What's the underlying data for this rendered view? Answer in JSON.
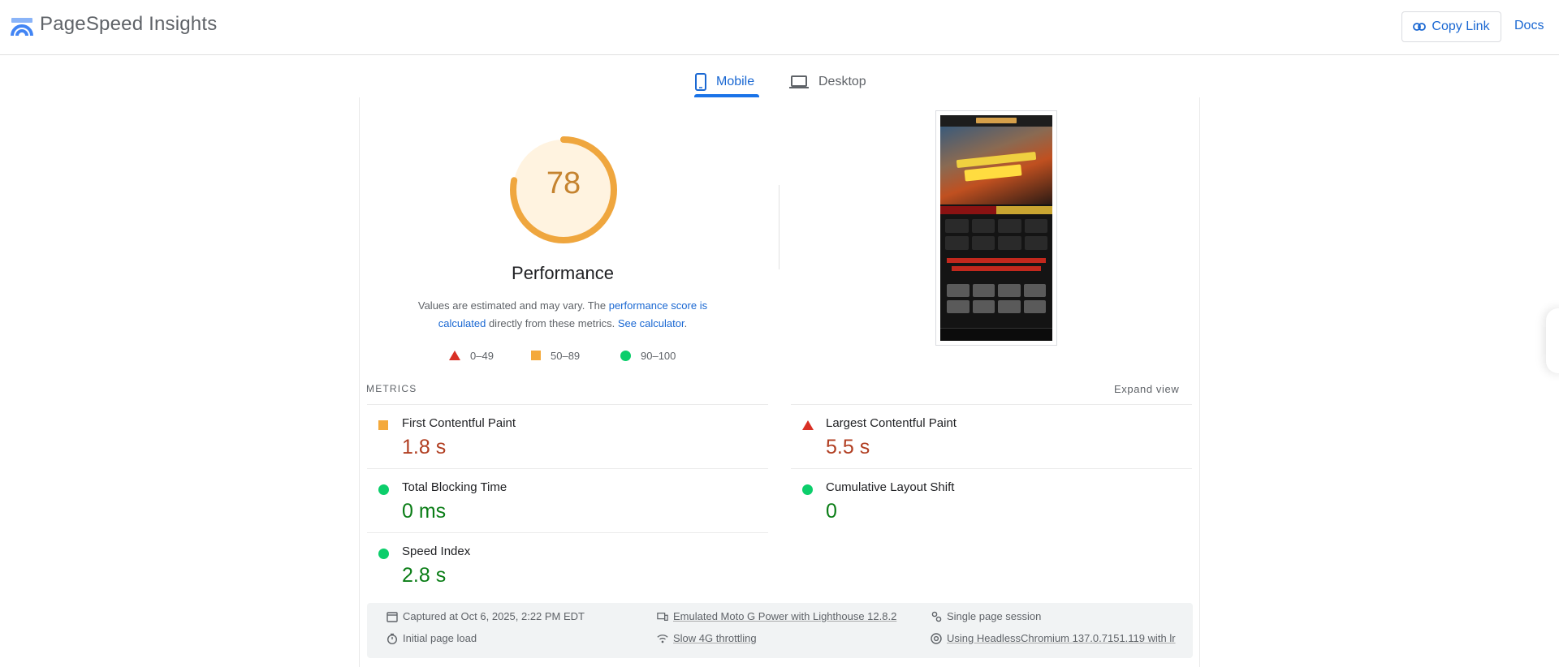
{
  "header": {
    "app_title": "PageSpeed Insights",
    "copy_link_label": "Copy Link",
    "docs_label": "Docs"
  },
  "tabs": [
    {
      "label": "Mobile",
      "active": true
    },
    {
      "label": "Desktop",
      "active": false
    }
  ],
  "performance": {
    "score": 78,
    "score_text": "78",
    "title": "Performance",
    "desc_prefix": "Values are estimated and may vary. The ",
    "desc_link1": "performance score is calculated",
    "desc_middle": " directly from these metrics. ",
    "desc_link2": "See calculator",
    "desc_suffix": ".",
    "legend": [
      {
        "range": "0–49",
        "shape": "triangle",
        "color": "#d93025"
      },
      {
        "range": "50–89",
        "shape": "square",
        "color": "#f4a93b"
      },
      {
        "range": "90–100",
        "shape": "circle",
        "color": "#0cce6b"
      }
    ],
    "gauge_color": "#efa63e",
    "gauge_fill": "#fff3e0"
  },
  "metrics": {
    "heading": "METRICS",
    "expand_label": "Expand view",
    "items": [
      {
        "name": "First Contentful Paint",
        "value": "1.8 s",
        "status": "average"
      },
      {
        "name": "Largest Contentful Paint",
        "value": "5.5 s",
        "status": "poor"
      },
      {
        "name": "Total Blocking Time",
        "value": "0 ms",
        "status": "good"
      },
      {
        "name": "Cumulative Layout Shift",
        "value": "0",
        "status": "good"
      },
      {
        "name": "Speed Index",
        "value": "2.8 s",
        "status": "good"
      }
    ]
  },
  "footer": {
    "captured": "Captured at Oct 6, 2025, 2:22 PM EDT",
    "initial_load": "Initial page load",
    "device": "Emulated Moto G Power with Lighthouse 12.8.2",
    "throttling": "Slow 4G throttling",
    "session": "Single page session",
    "browser": "Using HeadlessChromium 137.0.7151.119 with lr"
  },
  "colors": {
    "accent": "#1a73e8",
    "poor": "#d93025",
    "average": "#f4a93b",
    "good": "#0cce6b"
  }
}
